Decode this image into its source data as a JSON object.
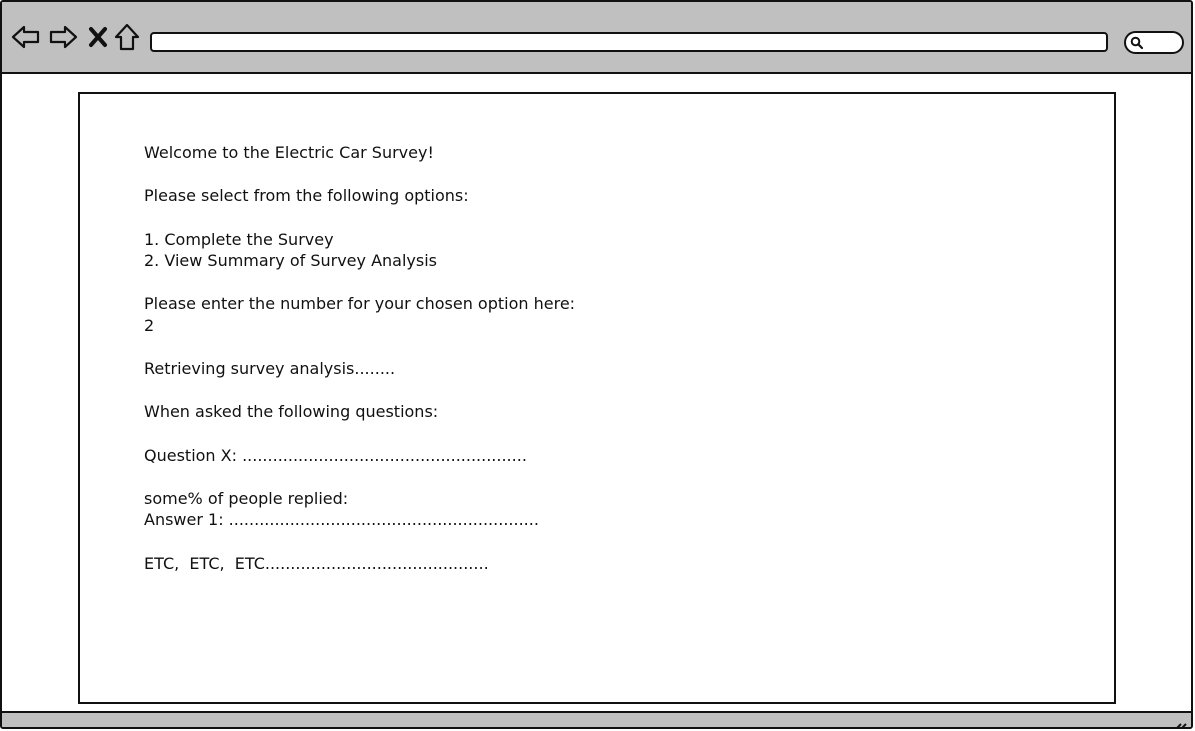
{
  "browser": {
    "toolbar": {
      "back_icon": "back-arrow-icon",
      "forward_icon": "forward-arrow-icon",
      "stop_icon": "close-icon",
      "home_icon": "home-icon",
      "address_value": "",
      "search_icon": "search-icon"
    }
  },
  "survey": {
    "welcome": "Welcome to the Electric Car Survey!",
    "select_prompt": "Please select from the following options:",
    "option_1": "1. Complete the Survey",
    "option_2": "2. View Summary of Survey Analysis",
    "enter_prompt": "Please enter the number for your chosen option here:",
    "entered_value": "2",
    "retrieving": "Retrieving survey analysis........",
    "when_asked": "When asked the following questions:",
    "question": "Question X: ........................................................",
    "percent_replied": "some% of people replied:",
    "answer": "Answer 1: .............................................................",
    "etc": "ETC,  ETC,  ETC............................................"
  }
}
